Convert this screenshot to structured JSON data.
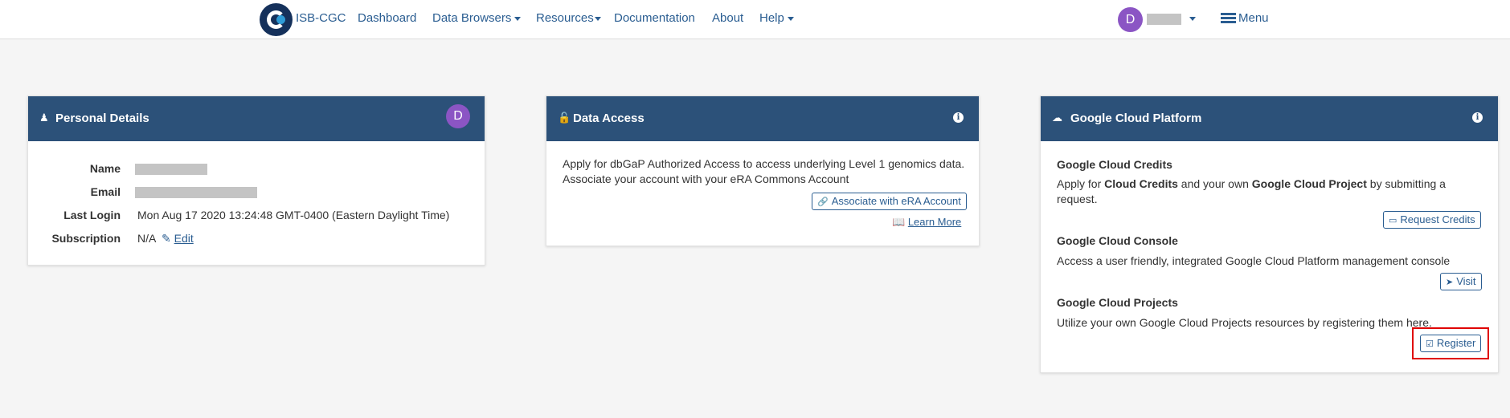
{
  "navbar": {
    "brand": "ISB-CGC",
    "items": [
      {
        "label": "Dashboard"
      },
      {
        "label": "Data Browsers"
      },
      {
        "label": "Resources"
      },
      {
        "label": "Documentation"
      },
      {
        "label": "About"
      },
      {
        "label": "Help"
      }
    ],
    "user_initial": "D",
    "menu_label": "Menu"
  },
  "personal": {
    "title": "Personal Details",
    "avatar_initial": "D",
    "labels": {
      "name": "Name",
      "email": "Email",
      "last_login": "Last Login",
      "subscription": "Subscription"
    },
    "last_login_value": "Mon Aug 17 2020 13:24:48 GMT-0400 (Eastern Daylight Time)",
    "subscription_value": "N/A",
    "edit_label": "Edit"
  },
  "data_access": {
    "title": "Data Access",
    "line1": "Apply for dbGaP Authorized Access to access underlying Level 1 genomics data.",
    "line2": "Associate your account with your eRA Commons Account",
    "associate_button": "Associate with eRA Account",
    "learn_more": "Learn More"
  },
  "gcp": {
    "title": "Google Cloud Platform",
    "credits": {
      "title": "Google Cloud Credits",
      "text_pre": "Apply for ",
      "bold1": "Cloud Credits",
      "text_mid": " and your own ",
      "bold2": "Google Cloud Project",
      "text_post": " by submitting a",
      "text_line2": "request.",
      "button": "Request Credits"
    },
    "console": {
      "title": "Google Cloud Console",
      "text": "Access a user friendly, integrated Google Cloud Platform management console",
      "button": "Visit"
    },
    "projects": {
      "title": "Google Cloud Projects",
      "text": "Utilize your own Google Cloud Projects resources by registering them here.",
      "button": "Register"
    }
  }
}
